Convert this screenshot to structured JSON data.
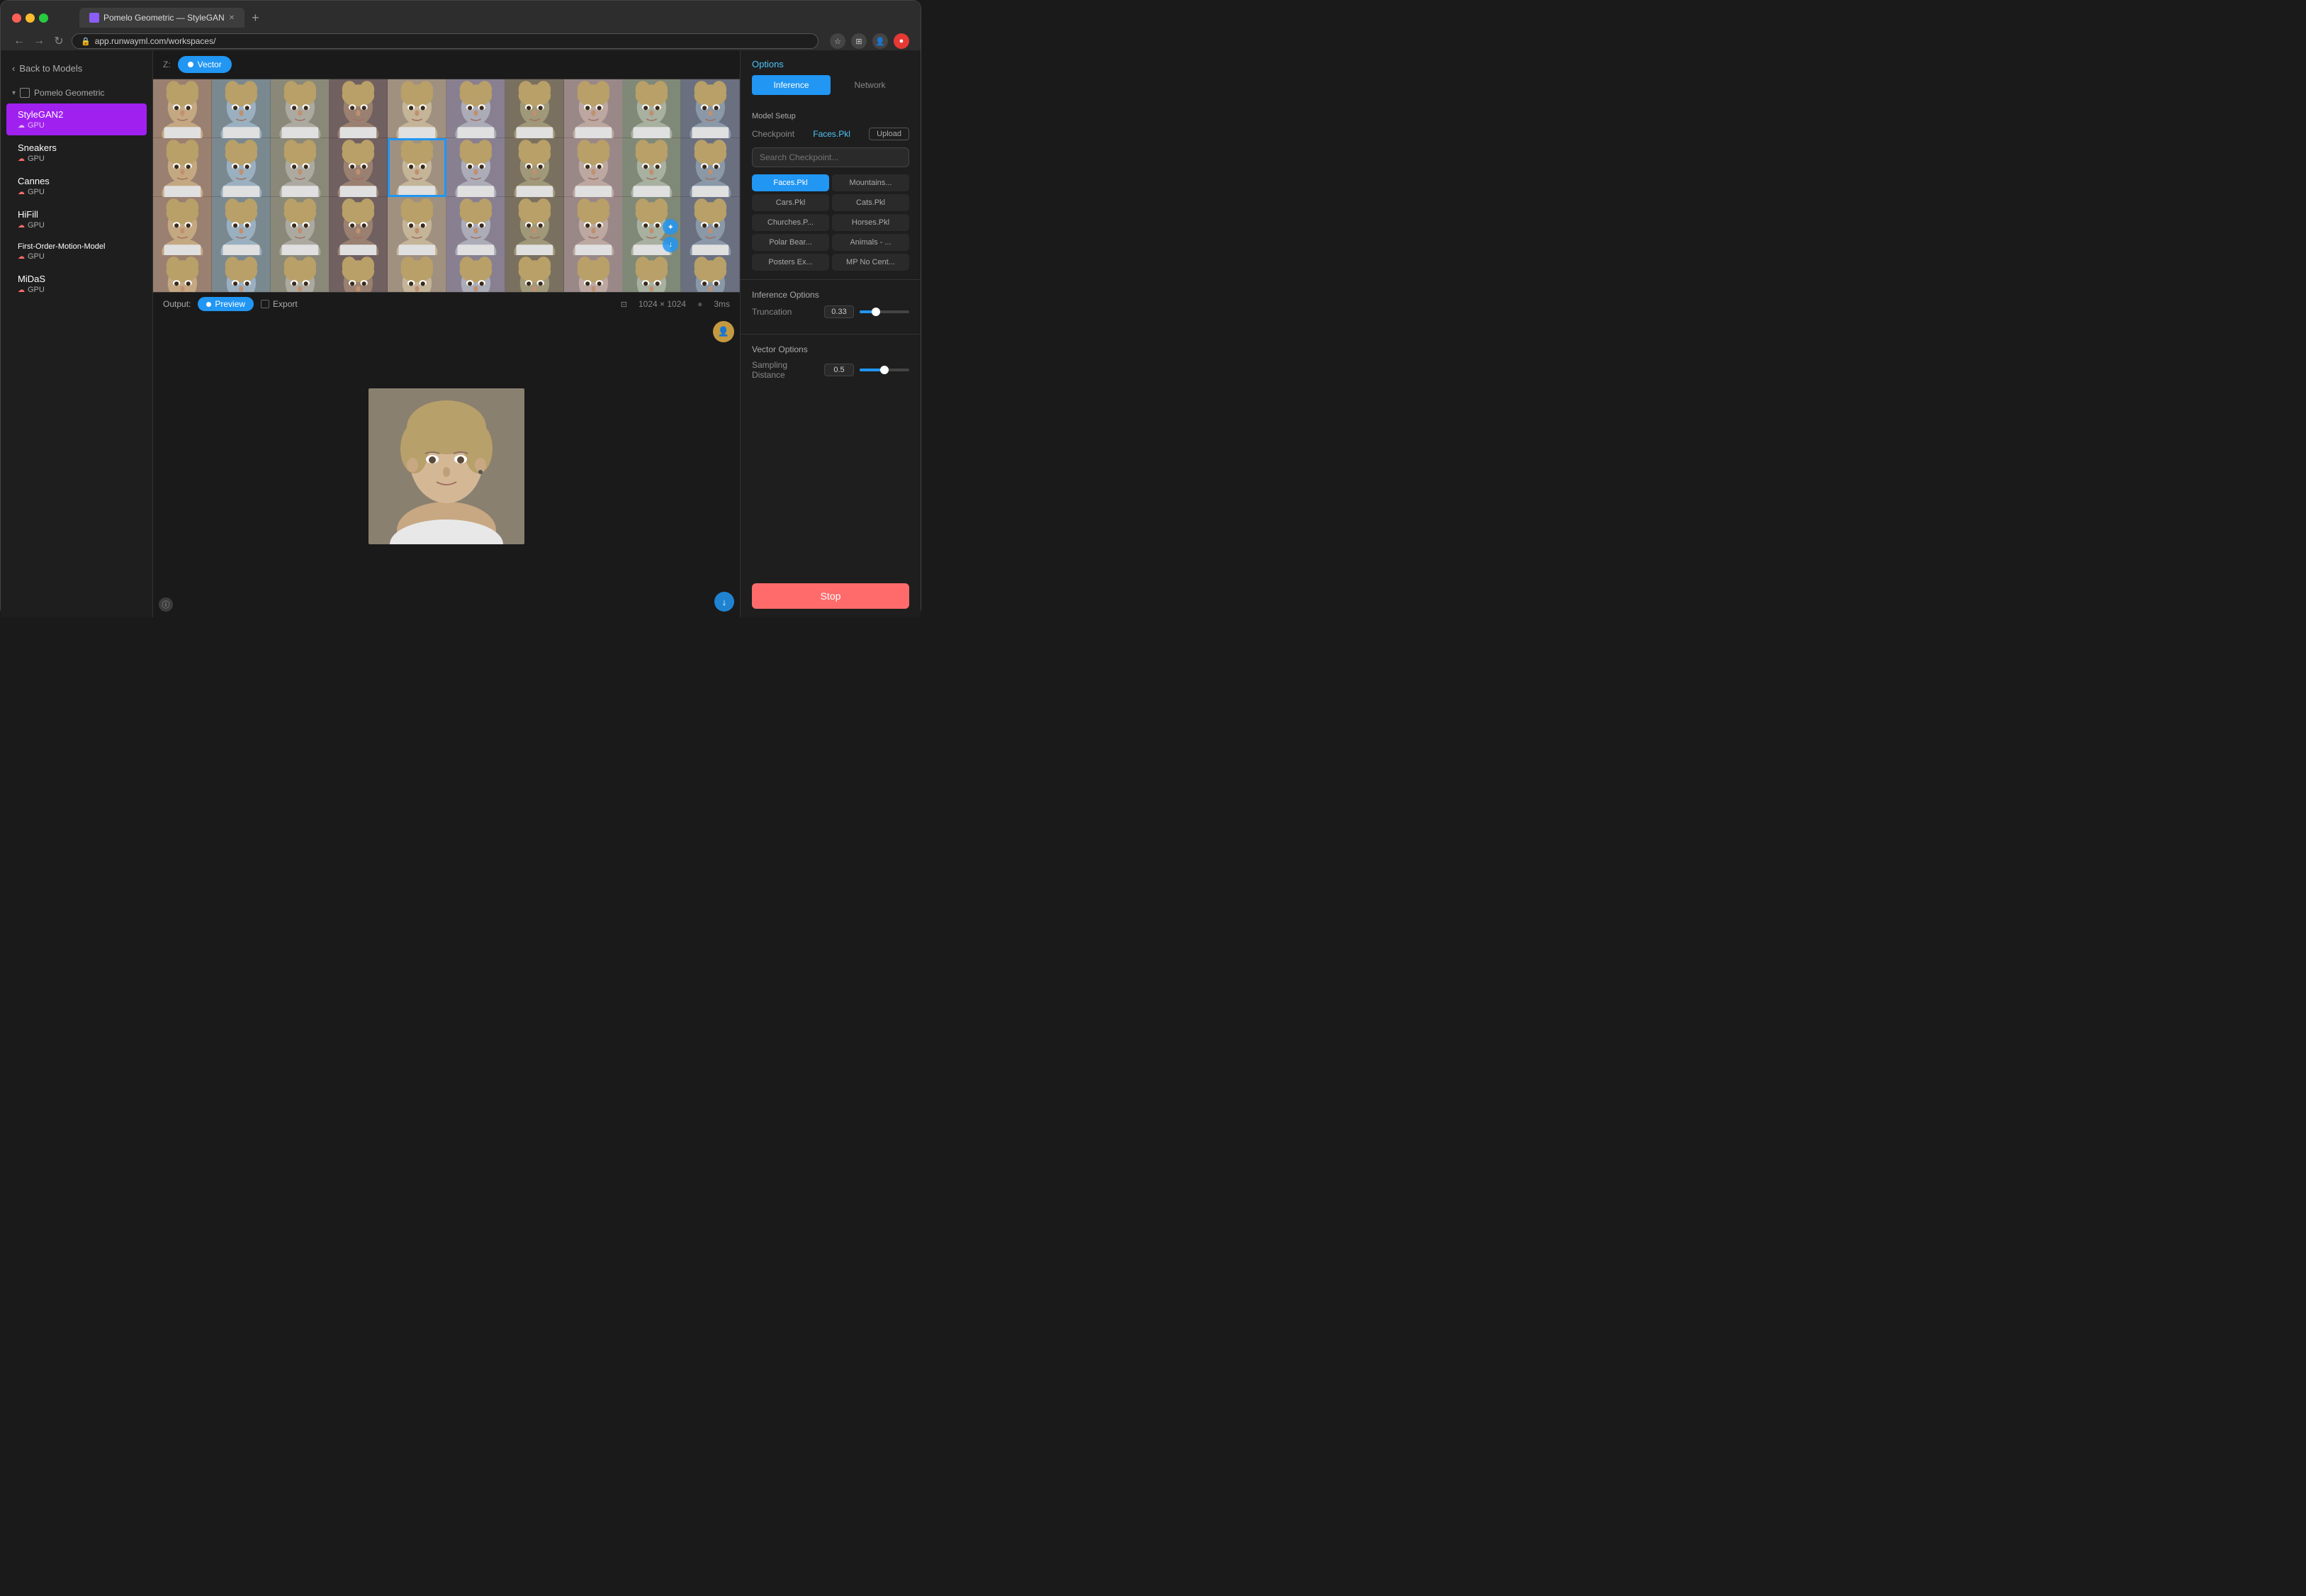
{
  "browser": {
    "tab_title": "Pomelo Geometric — StyleGAN",
    "address": "app.runwayml.com/workspaces/",
    "tab_favicon": "R"
  },
  "sidebar": {
    "back_label": "Back to Models",
    "workspace_name": "Pomelo Geometric",
    "models": [
      {
        "name": "StyleGAN2",
        "badge": "GPU",
        "active": true
      },
      {
        "name": "Sneakers",
        "badge": "GPU",
        "active": false
      },
      {
        "name": "Cannes",
        "badge": "GPU",
        "active": false
      },
      {
        "name": "HiFill",
        "badge": "GPU",
        "active": false
      },
      {
        "name": "First-Order-Motion-Model",
        "badge": "GPU",
        "active": false
      },
      {
        "name": "MiDaS",
        "badge": "GPU",
        "active": false
      }
    ]
  },
  "toolbar": {
    "z_label": "Z:",
    "vector_label": "Vector"
  },
  "options_panel": {
    "title": "Options",
    "inference_tab": "Inference",
    "network_tab": "Network",
    "model_setup_label": "Model Setup",
    "checkpoint_key": "Checkpoint",
    "checkpoint_value": "Faces.Pkl",
    "upload_label": "Upload",
    "search_placeholder": "Search Checkpoint...",
    "checkpoints": [
      {
        "name": "Faces.Pkl",
        "active": true
      },
      {
        "name": "Mountains...",
        "active": false
      },
      {
        "name": "Cars.Pkl",
        "active": false
      },
      {
        "name": "Cats.Pkl",
        "active": false
      },
      {
        "name": "Churches.P...",
        "active": false
      },
      {
        "name": "Horses.Pkl",
        "active": false
      },
      {
        "name": "Polar Bear...",
        "active": false
      },
      {
        "name": "Animals - ...",
        "active": false
      },
      {
        "name": "Posters Ex...",
        "active": false
      },
      {
        "name": "MP No Cent...",
        "active": false
      }
    ],
    "inference_options_label": "Inference Options",
    "truncation_label": "Truncation",
    "truncation_value": "0.33",
    "truncation_pct": 33,
    "vector_options_label": "Vector Options",
    "sampling_distance_label": "Sampling Distance",
    "sampling_distance_value": "0.5",
    "sampling_distance_pct": 50,
    "stop_label": "Stop"
  },
  "output_bar": {
    "output_label": "Output:",
    "preview_label": "Preview",
    "export_label": "Export",
    "dimensions": "1024 × 1024",
    "time": "3ms"
  }
}
